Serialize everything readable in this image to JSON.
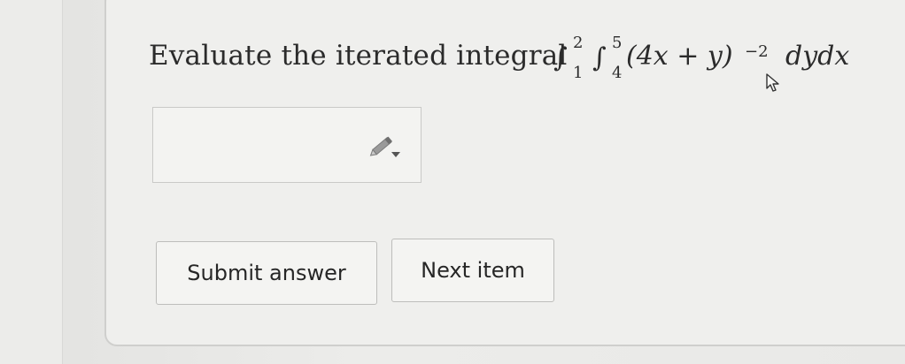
{
  "question": {
    "prompt": "Evaluate the iterated integral",
    "outer_upper": "2",
    "outer_lower": "1",
    "inner_upper": "5",
    "inner_lower": "4",
    "integrand": "(4x + y)",
    "exponent": "−2",
    "differentials": "dydx"
  },
  "answer": {
    "value": "",
    "placeholder": "",
    "editor_icon": "pencil-dropdown-icon"
  },
  "buttons": {
    "submit_label": "Submit answer",
    "next_label": "Next item"
  },
  "pointer": {
    "icon": "mouse-cursor-icon"
  },
  "colors": {
    "background": "#e7e7e5",
    "card": "#efefed",
    "text": "#2b2b2b",
    "button_border": "#bdbdbb"
  }
}
